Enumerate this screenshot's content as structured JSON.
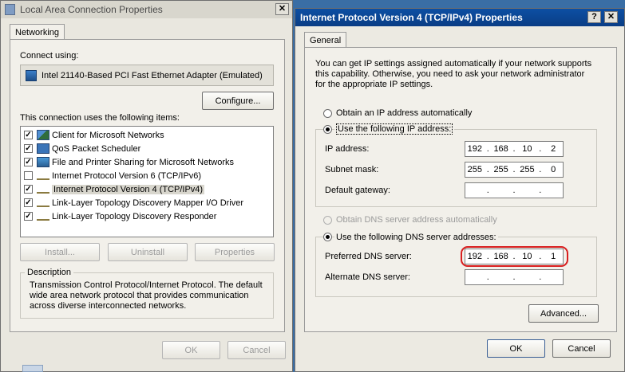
{
  "window_lan": {
    "title": "Local Area Connection Properties",
    "close_glyph": "✕",
    "tab": "Networking",
    "connect_using_label": "Connect using:",
    "adapter_name": "Intel 21140-Based PCI Fast Ethernet Adapter (Emulated)",
    "configure_button": "Configure...",
    "items_label": "This connection uses the following items:",
    "items": [
      {
        "label": "Client for Microsoft Networks",
        "checked": true,
        "icon": "network-client-icon"
      },
      {
        "label": "QoS Packet Scheduler",
        "checked": true,
        "icon": "scheduler-icon"
      },
      {
        "label": "File and Printer Sharing for Microsoft Networks",
        "checked": true,
        "icon": "sharing-icon"
      },
      {
        "label": "Internet Protocol Version 6 (TCP/IPv6)",
        "checked": false,
        "icon": "protocol-icon"
      },
      {
        "label": "Internet Protocol Version 4 (TCP/IPv4)",
        "checked": true,
        "icon": "protocol-icon",
        "selected": true
      },
      {
        "label": "Link-Layer Topology Discovery Mapper I/O Driver",
        "checked": true,
        "icon": "protocol-icon"
      },
      {
        "label": "Link-Layer Topology Discovery Responder",
        "checked": true,
        "icon": "protocol-icon"
      }
    ],
    "check_glyph": "✓",
    "install_button": "Install...",
    "uninstall_button": "Uninstall",
    "properties_button": "Properties",
    "description_label": "Description",
    "description_line1": "Transmission Control Protocol/Internet Protocol. The default",
    "description_line2": "wide area network protocol that provides communication",
    "description_line3": "across diverse interconnected networks.",
    "ok_button": "OK",
    "cancel_button": "Cancel"
  },
  "window_ipv4": {
    "title": "Internet Protocol Version 4 (TCP/IPv4) Properties",
    "help_glyph": "?",
    "close_glyph": "✕",
    "tab": "General",
    "intro_line1": "You can get IP settings assigned automatically if your network supports",
    "intro_line2": "this capability. Otherwise, you need to ask your network administrator",
    "intro_line3": "for the appropriate IP settings.",
    "radio_auto_ip": "Obtain an IP address automatically",
    "radio_static_ip": "Use the following IP address:",
    "ip_address_label": "IP address:",
    "ip_address": [
      "192",
      "168",
      "10",
      "2"
    ],
    "subnet_mask_label": "Subnet mask:",
    "subnet_mask": [
      "255",
      "255",
      "255",
      "0"
    ],
    "gateway_label": "Default gateway:",
    "gateway": [
      "",
      "",
      "",
      ""
    ],
    "radio_auto_dns": "Obtain DNS server address automatically",
    "radio_static_dns": "Use the following DNS server addresses:",
    "preferred_dns_label": "Preferred DNS server:",
    "preferred_dns": [
      "192",
      "168",
      "10",
      "1"
    ],
    "alternate_dns_label": "Alternate DNS server:",
    "alternate_dns": [
      "",
      "",
      "",
      ""
    ],
    "ip_dot": ".",
    "advanced_button": "Advanced...",
    "ok_button": "OK",
    "cancel_button": "Cancel",
    "highlight_color": "#d81e1e"
  }
}
